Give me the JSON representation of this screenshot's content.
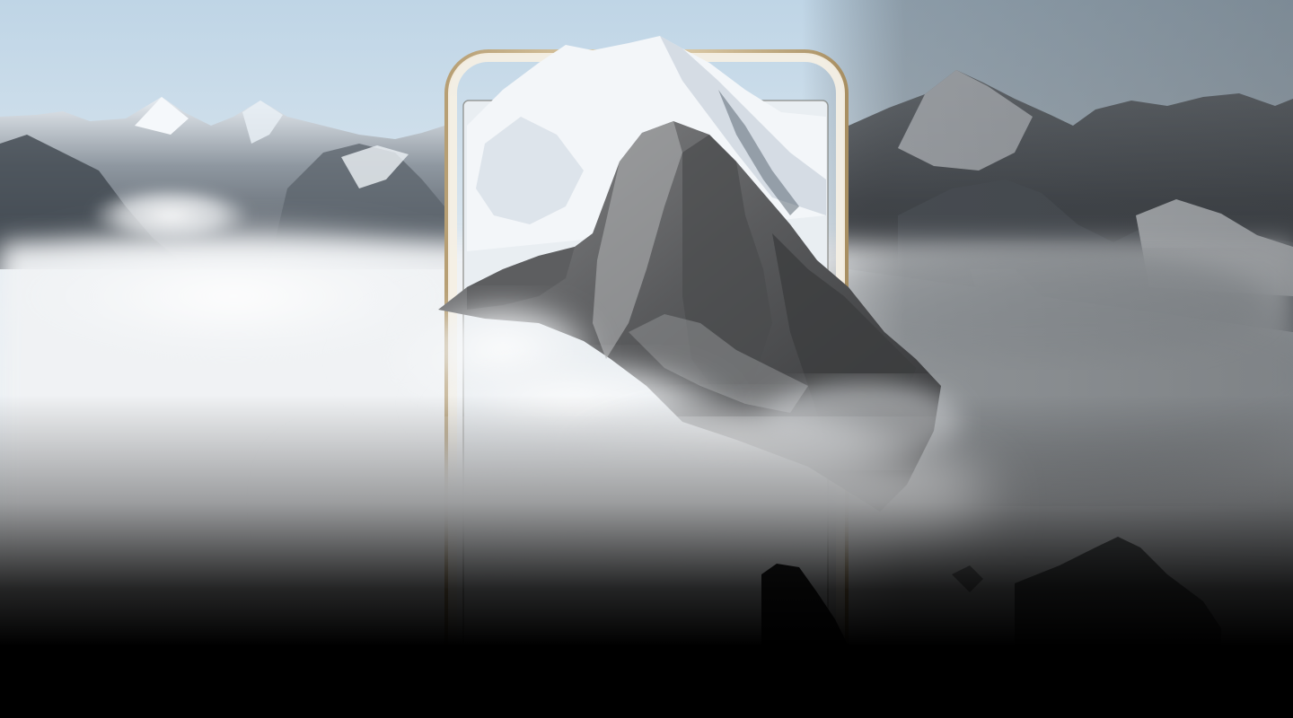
{
  "scene": {
    "subject": "phone-frame-over-mountain-peaks",
    "icons": [
      "mountain-range-left",
      "mountain-range-right",
      "central-rock-peak",
      "snow-summit",
      "cloud-sea",
      "smartphone-frame"
    ]
  },
  "colors": {
    "sky_top": "#c9dceb",
    "sky_bottom": "#f0f4f7",
    "sky_right": "#6e7479",
    "snow": "#f4f7fa",
    "rock_dark": "#3b3c3e",
    "rock_mid": "#6a6b6d",
    "rock_light": "#9c9d9f",
    "cloud": "#f5f6f7",
    "phone_gold": "#c8b48c",
    "phone_frame_inner": "#efe9de",
    "bottom_fade": "#000000"
  }
}
